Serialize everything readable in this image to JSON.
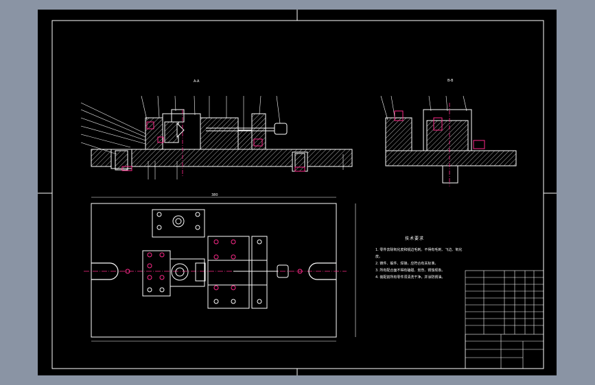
{
  "drawing": {
    "view_a_label": "A-A",
    "view_b_label": "B-B",
    "dim_top": "380",
    "tech_req_title": "技术要求",
    "tech_req_lines": [
      "1. 零件去除氧化皮和锐边毛刺。不得有毛刺、飞边、氧化皮。",
      "2. 铸件、锻件、焊接，应符合有关标准。",
      "3. 所有配合面不得有磕碰、划伤、锈蚀现象。",
      "4. 装配前所有零件须清洗干净，并涂防锈油。"
    ]
  },
  "colors": {
    "sheet": "#000000",
    "line": "#ffffff",
    "accent": "#ff2a8a",
    "background": "#8a94a4"
  }
}
